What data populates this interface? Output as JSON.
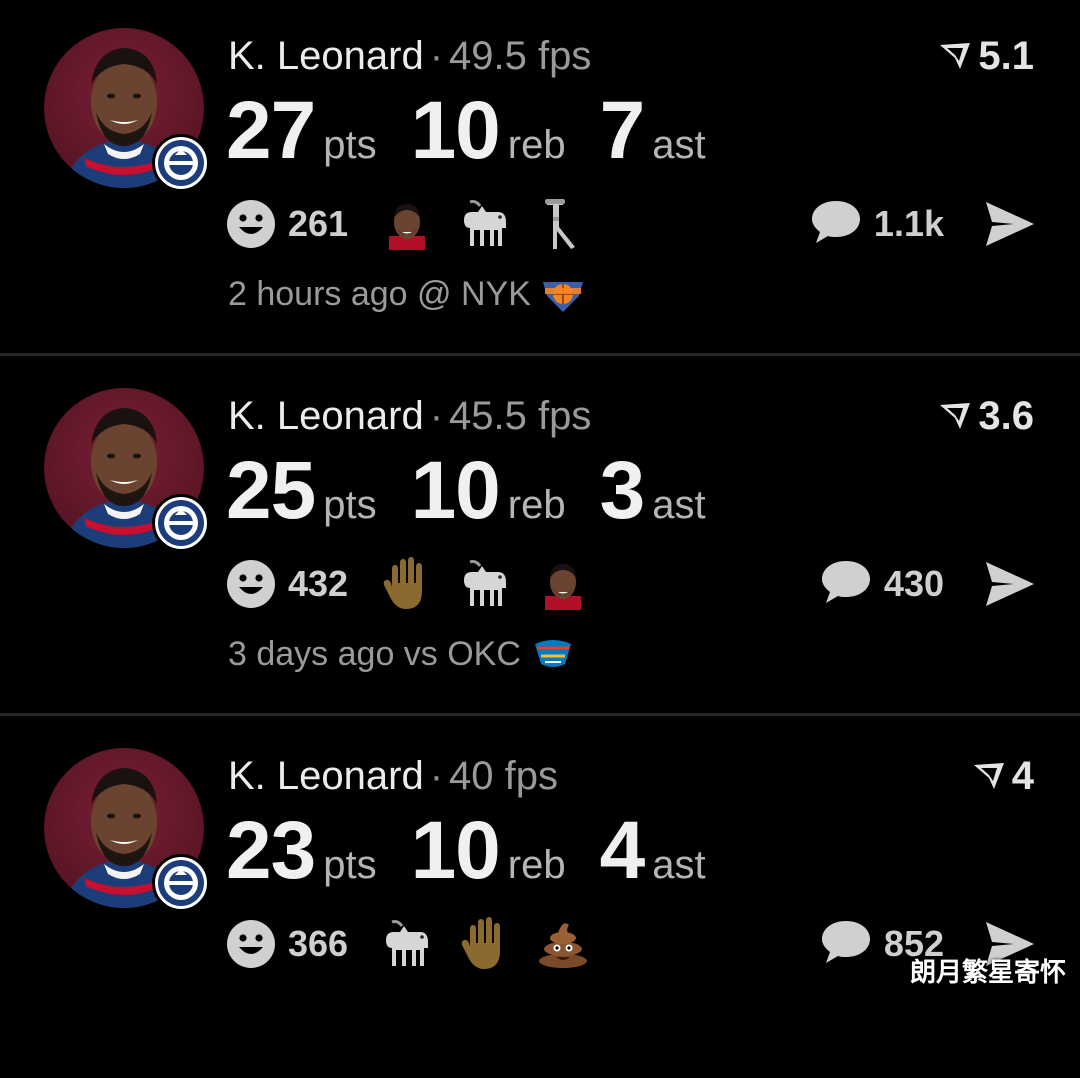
{
  "posts": [
    {
      "player": "K. Leonard",
      "separator": "·",
      "fps": "49.5 fps",
      "rating": "5.1",
      "pts": "27",
      "pts_label": "pts",
      "reb": "10",
      "reb_label": "reb",
      "ast": "7",
      "ast_label": "ast",
      "reactions_count": "261",
      "reaction_emojis": [
        "player-face-emoji",
        "goat-emoji",
        "crutch-emoji"
      ],
      "comments_count": "1.1k",
      "time": "2 hours ago @ NYK",
      "opponent_logo": "knicks-logo"
    },
    {
      "player": "K. Leonard",
      "separator": "·",
      "fps": "45.5 fps",
      "rating": "3.6",
      "pts": "25",
      "pts_label": "pts",
      "reb": "10",
      "reb_label": "reb",
      "ast": "3",
      "ast_label": "ast",
      "reactions_count": "432",
      "reaction_emojis": [
        "raised-hand-emoji",
        "goat-emoji",
        "player-face-emoji"
      ],
      "comments_count": "430",
      "time": "3 days ago vs OKC",
      "opponent_logo": "thunder-logo"
    },
    {
      "player": "K. Leonard",
      "separator": "·",
      "fps": "40 fps",
      "rating": "4",
      "pts": "23",
      "pts_label": "pts",
      "reb": "10",
      "reb_label": "reb",
      "ast": "4",
      "ast_label": "ast",
      "reactions_count": "366",
      "reaction_emojis": [
        "goat-emoji",
        "raised-hand-emoji",
        "poop-emoji"
      ],
      "comments_count": "852"
    }
  ],
  "watermark": "朗月繁星寄怀",
  "colors": {
    "background": "#000000",
    "avatar_bg": "#6a1a2c",
    "text_primary": "#f0f0f0",
    "text_secondary": "#9a9a9a",
    "icon_gray": "#d0d0d0",
    "divider": "#262626"
  }
}
